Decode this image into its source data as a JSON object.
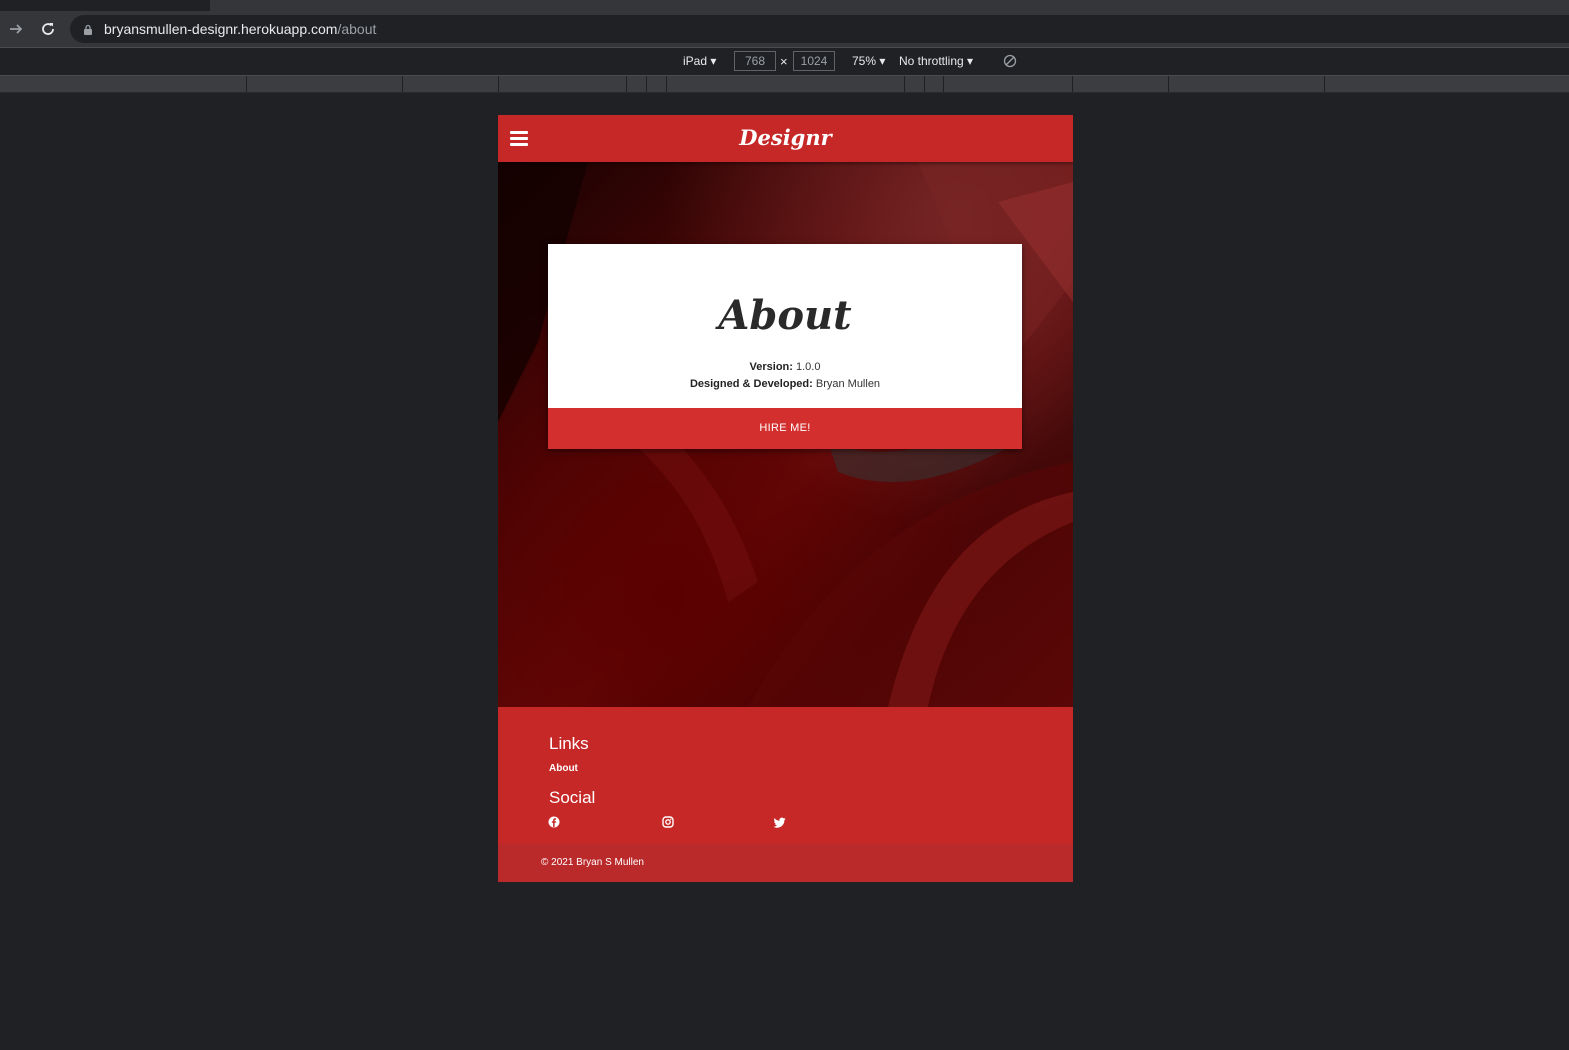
{
  "browser": {
    "url_host": "bryansmullen-designr.herokuapp.com",
    "url_path": "/about"
  },
  "device_toolbar": {
    "device": "iPad",
    "width": "768",
    "height": "1024",
    "separator": "×",
    "zoom": "75%",
    "throttling": "No throttling"
  },
  "site": {
    "brand": "Designr",
    "about_card": {
      "title": "About",
      "version_label": "Version:",
      "version_value": "1.0.0",
      "developer_label": "Designed & Developed:",
      "developer_value": "Bryan Mullen",
      "hire_button": "HIRE ME!"
    },
    "footer": {
      "links_heading": "Links",
      "links": [
        "About"
      ],
      "social_heading": "Social",
      "social_icons": [
        "facebook-icon",
        "instagram-icon",
        "twitter-icon"
      ],
      "copyright": "© 2021 Bryan S Mullen"
    },
    "colors": {
      "primary": "#c62828",
      "button": "#d32f2f"
    }
  }
}
